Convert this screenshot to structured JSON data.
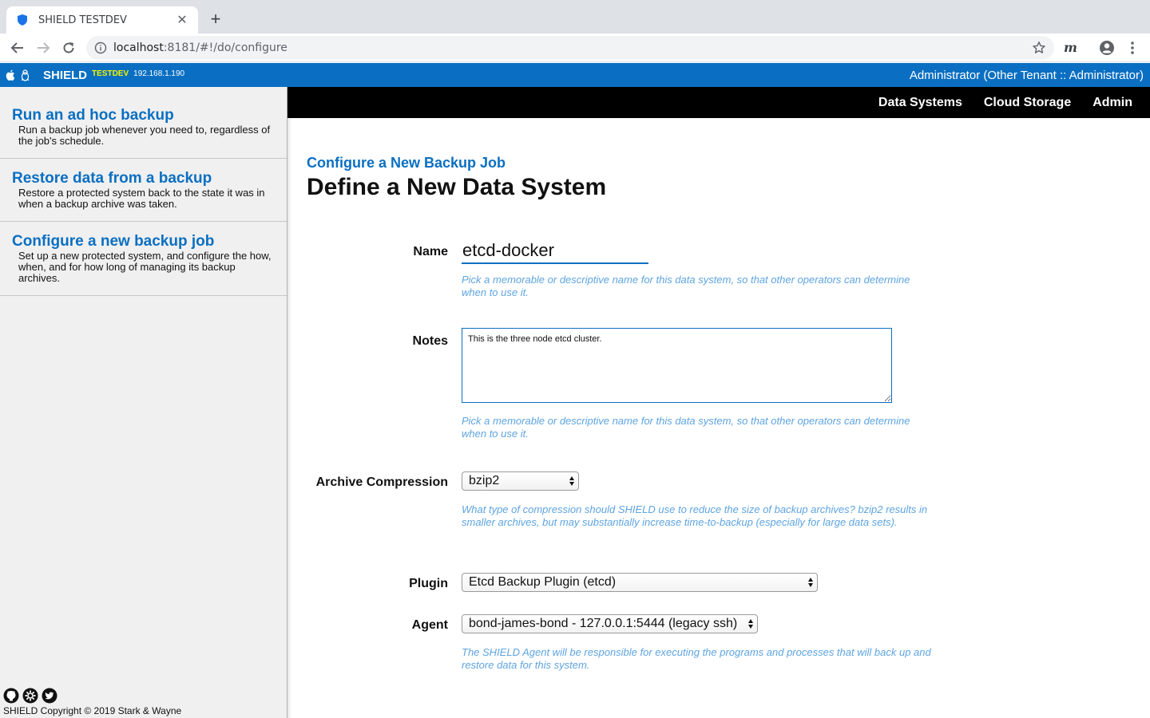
{
  "browser": {
    "tab_title": "SHIELD TESTDEV",
    "url_host": "localhost",
    "url_rest": ":8181/#!/do/configure",
    "ext_label": "m"
  },
  "appbar": {
    "brand": "SHIELD",
    "env": "TESTDEV",
    "ip": "192.168.1.190",
    "user": "Administrator (Other Tenant :: Administrator)"
  },
  "sidebar": {
    "items": [
      {
        "title": "Run an ad hoc backup",
        "desc": "Run a backup job whenever you need to, regardless of the job's schedule."
      },
      {
        "title": "Restore data from a backup",
        "desc": "Restore a protected system back to the state it was in when a backup archive was taken."
      },
      {
        "title": "Configure a new backup job",
        "desc": "Set up a new protected system, and configure the how, when, and for how long of managing its backup archives."
      }
    ],
    "copyright": "SHIELD Copyright © 2019 Stark & Wayne"
  },
  "nav": {
    "items": [
      "Data Systems",
      "Cloud Storage",
      "Admin"
    ]
  },
  "page": {
    "crumb": "Configure a New Backup Job",
    "title": "Define a New Data System"
  },
  "form": {
    "name_label": "Name",
    "name_value": "etcd-docker",
    "name_help": "Pick a memorable or descriptive name for this data system, so that other operators can determine when to use it.",
    "notes_label": "Notes",
    "notes_value": "This is the three node etcd cluster.",
    "notes_help": "Pick a memorable or descriptive name for this data system, so that other operators can determine when to use it.",
    "compression_label": "Archive Compression",
    "compression_value": "bzip2",
    "compression_help": "What type of compression should SHIELD use to reduce the size of backup archives? bzip2 results in smaller archives, but may substantially increase time-to-backup (especially for large data sets).",
    "plugin_label": "Plugin",
    "plugin_value": "Etcd Backup Plugin (etcd)",
    "agent_label": "Agent",
    "agent_value": "bond-james-bond - 127.0.0.1:5444 (legacy ssh)",
    "agent_help": "The SHIELD Agent will be responsible for executing the programs and processes that will back up and restore data for this system."
  },
  "colors": {
    "brand_blue": "#0a6fc2",
    "env_yellow": "#f4f400",
    "help_blue": "#5ea4e0"
  }
}
